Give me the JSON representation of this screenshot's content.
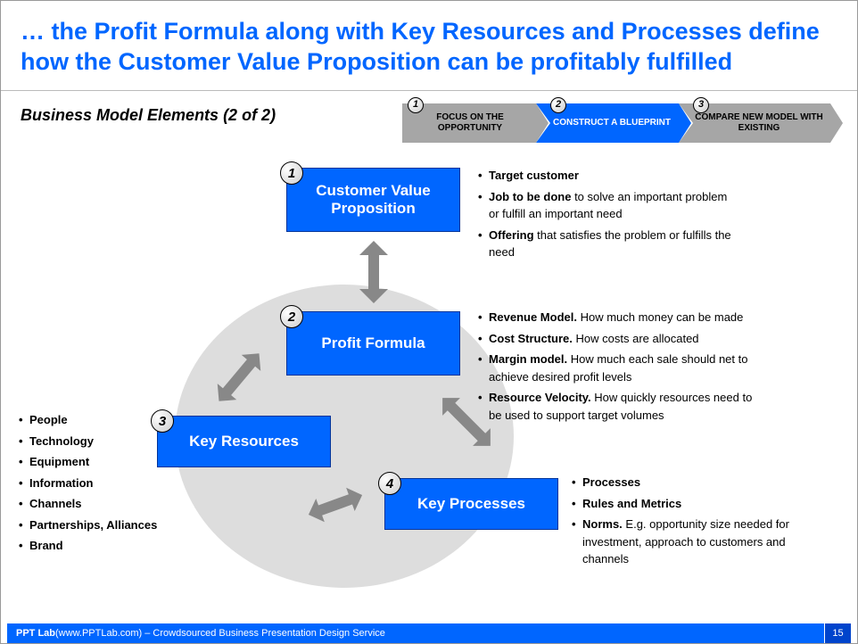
{
  "title": "… the Profit Formula along with Key Resources and Processes define how the Customer Value Proposition can be profitably fulfilled",
  "subtitle": "Business Model Elements (2 of 2)",
  "stepper": {
    "s1": "FOCUS ON THE OPPORTUNITY",
    "s2": "CONSTRUCT A BLUEPRINT",
    "s3": "COMPARE NEW MODEL WITH EXISTING",
    "n1": "1",
    "n2": "2",
    "n3": "3"
  },
  "boxes": {
    "b1": {
      "num": "1",
      "label": "Customer Value Proposition"
    },
    "b2": {
      "num": "2",
      "label": "Profit Formula"
    },
    "b3": {
      "num": "3",
      "label": "Key Resources"
    },
    "b4": {
      "num": "4",
      "label": "Key Processes"
    }
  },
  "bullets1": [
    {
      "b": "Target customer",
      "t": ""
    },
    {
      "b": "Job to be done",
      "t": " to solve an important problem or fulfill an important need"
    },
    {
      "b": "Offering",
      "t": " that satisfies the problem or fulfills the need"
    }
  ],
  "bullets2": [
    {
      "b": "Revenue Model.",
      "t": " How much money can be made"
    },
    {
      "b": "Cost Structure.",
      "t": " How costs are allocated"
    },
    {
      "b": "Margin model.",
      "t": " How much each sale should net to achieve desired profit levels"
    },
    {
      "b": "Resource Velocity.",
      "t": " How quickly resources need to be used to support target volumes"
    }
  ],
  "bullets3": [
    "People",
    "Technology",
    "Equipment",
    "Information",
    "Channels",
    "Partnerships, Alliances",
    "Brand"
  ],
  "bullets4": [
    {
      "b": "Processes",
      "t": ""
    },
    {
      "b": "Rules and Metrics",
      "t": ""
    },
    {
      "b": "Norms.",
      "t": " E.g. opportunity size needed for investment, approach to customers and channels"
    }
  ],
  "footer": {
    "brand": "PPT Lab",
    "text": " (www.PPTLab.com) – Crowdsourced Business Presentation Design Service",
    "page": "15"
  }
}
